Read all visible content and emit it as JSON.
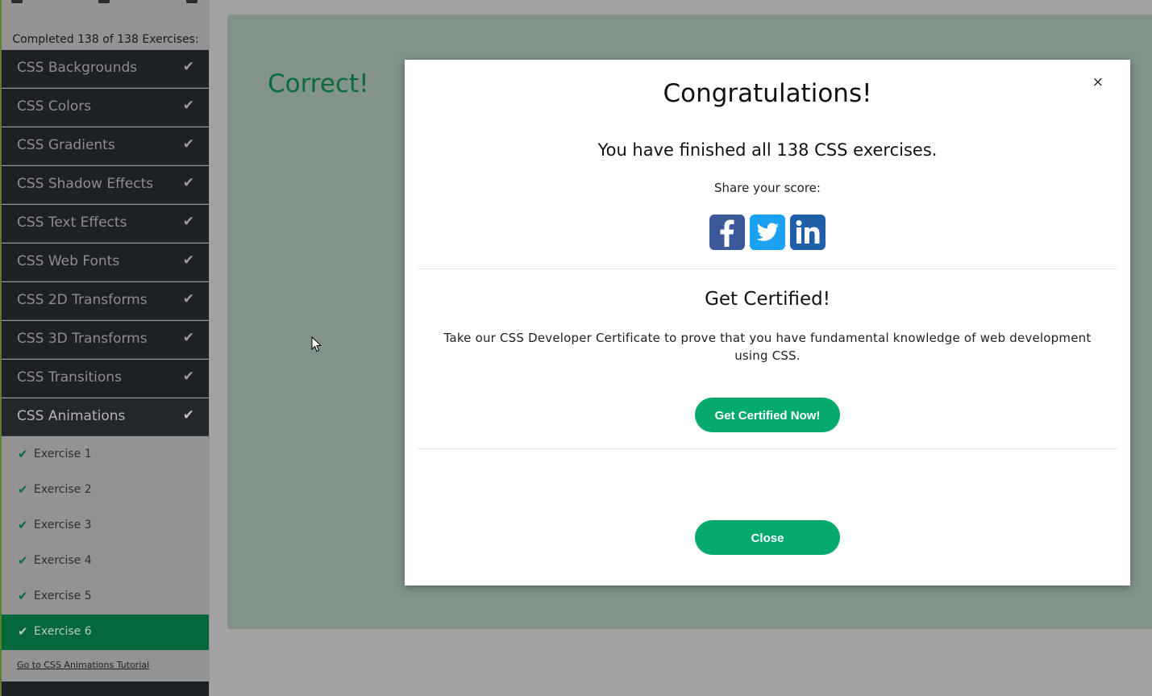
{
  "sidebar": {
    "progress_text": "Completed 138 of 138 Exercises:",
    "categories": [
      {
        "label": "CSS Backgrounds"
      },
      {
        "label": "CSS Colors"
      },
      {
        "label": "CSS Gradients"
      },
      {
        "label": "CSS Shadow Effects"
      },
      {
        "label": "CSS Text Effects"
      },
      {
        "label": "CSS Web Fonts"
      },
      {
        "label": "CSS 2D Transforms"
      },
      {
        "label": "CSS 3D Transforms"
      },
      {
        "label": "CSS Transitions"
      },
      {
        "label": "CSS Animations"
      }
    ],
    "check_glyph": "✔",
    "exercises": [
      {
        "label": "Exercise 1"
      },
      {
        "label": "Exercise 2"
      },
      {
        "label": "Exercise 3"
      },
      {
        "label": "Exercise 4"
      },
      {
        "label": "Exercise 5"
      },
      {
        "label": "Exercise 6"
      }
    ],
    "tutorial_link": "Go to CSS Animations Tutorial"
  },
  "main": {
    "result_text": "Correct!"
  },
  "modal": {
    "close_x": "×",
    "title": "Congratulations!",
    "finished_text": "You have finished all 138 CSS exercises.",
    "share_label": "Share your score:",
    "social_icons": [
      "facebook-icon",
      "twitter-icon",
      "linkedin-icon"
    ],
    "cert_heading": "Get Certified!",
    "cert_description": "Take our CSS Developer Certificate to prove that you have fundamental knowledge of web development using CSS.",
    "cert_button": "Get Certified Now!",
    "close_button": "Close"
  },
  "colors": {
    "brand_green": "#04aa6d",
    "dark_green": "#05683a",
    "sidebar_dark": "#1d2024"
  }
}
